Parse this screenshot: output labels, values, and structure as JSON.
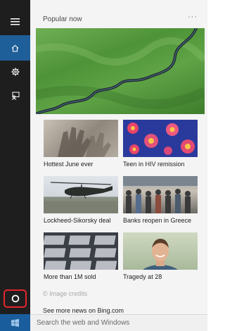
{
  "section": {
    "title": "Popular now",
    "more_label": "···"
  },
  "tiles": [
    {
      "caption": "Hottest June ever"
    },
    {
      "caption": "Teen in HIV remission"
    },
    {
      "caption": "Lockheed-Sikorsky deal"
    },
    {
      "caption": "Banks reopen in Greece"
    },
    {
      "caption": "More than 1M sold"
    },
    {
      "caption": "Tragedy at 28"
    }
  ],
  "footer": {
    "credits": "© Image credits",
    "see_more": "See more news on Bing.com"
  },
  "search": {
    "placeholder": "Search the web and Windows"
  },
  "rail": {
    "icons": [
      "hamburger-menu-icon",
      "home-icon",
      "gear-icon",
      "feedback-icon",
      "cortana-circle-icon",
      "windows-logo-icon"
    ]
  },
  "colors": {
    "rail_bg": "#1e1e1e",
    "active_accent": "#1f5f99",
    "cortana_highlight": "#e5262c",
    "content_bg": "#f4f4f4"
  }
}
